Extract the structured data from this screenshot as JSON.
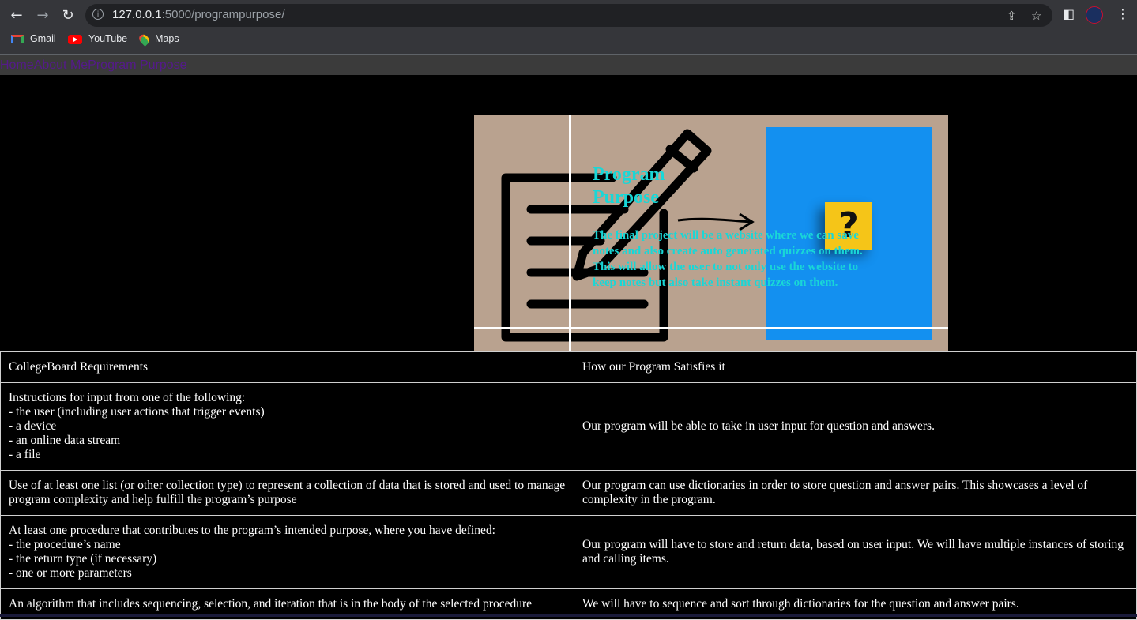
{
  "browser": {
    "url_host": "127.0.0.1",
    "url_path": ":5000/programpurpose/",
    "back_icon": "arrow-left-icon",
    "forward_icon": "arrow-right-icon",
    "reload_icon": "reload-icon",
    "bookmarks": [
      {
        "label": "Gmail",
        "icon": "gmail-icon"
      },
      {
        "label": "YouTube",
        "icon": "youtube-icon"
      },
      {
        "label": "Maps",
        "icon": "maps-icon"
      }
    ]
  },
  "nav": {
    "links": [
      "Home",
      "About Me",
      "Program Purpose"
    ]
  },
  "hero": {
    "title": "Program Purpose",
    "text": "The final project will be a website where we can save notes and also create auto generated quizzes on them. This will allow the user to not only use the website to keep notes but also take instant quizzes on them.",
    "cube_glyph": "?",
    "colors": {
      "background": "#b9a28f",
      "blue_panel": "#1390f0",
      "text": "#19d7d7"
    }
  },
  "table": {
    "headers": [
      "CollegeBoard Requirements",
      "How our Program Satisfies it"
    ],
    "rows": [
      {
        "req": [
          "Instructions for input from one of the following:",
          "- the user (including user actions that trigger events)",
          "- a device",
          "- an online data stream",
          "- a file"
        ],
        "how": "Our program will be able to take in user input for question and answers."
      },
      {
        "req": [
          "Use of at least one list (or other collection type) to represent a collection of data that is stored and used to manage program complexity and help fulfill the program’s purpose"
        ],
        "how": "Our program can use dictionaries in order to store question and answer pairs. This showcases a level of complexity in the program."
      },
      {
        "req": [
          "At least one procedure that contributes to the program’s intended purpose, where you have defined:",
          "- the procedure’s name",
          "- the return type (if necessary)",
          "- one or more parameters"
        ],
        "how": "Our program will have to store and return data, based on user input. We will have multiple instances of storing and calling items."
      },
      {
        "req": [
          "An algorithm that includes sequencing, selection, and iteration that is in the body of the selected procedure"
        ],
        "how": "We will have to sequence and sort through dictionaries for the question and answer pairs."
      }
    ]
  }
}
